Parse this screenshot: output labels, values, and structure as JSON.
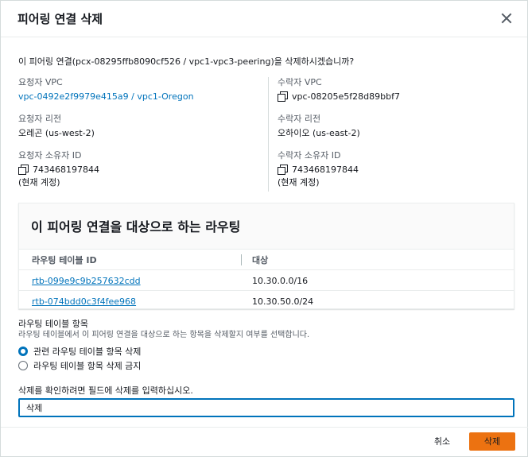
{
  "dialog": {
    "title": "피어링 연결 삭제",
    "question": "이 피어링 연결(pcx-08295ffb8090cf526 / vpc1-vpc3-peering)을 삭제하시겠습니까?"
  },
  "requester": {
    "vpc_label": "요청자 VPC",
    "vpc_value": "vpc-0492e2f9979e415a9 / vpc1-Oregon",
    "region_label": "요청자 리전",
    "region_value": "오레곤 (us-west-2)",
    "owner_label": "요청자 소유자 ID",
    "owner_value": "743468197844",
    "owner_note": "(현재 계정)"
  },
  "accepter": {
    "vpc_label": "수락자 VPC",
    "vpc_value": "vpc-08205e5f28d89bbf7",
    "region_label": "수락자 리전",
    "region_value": "오하이오 (us-east-2)",
    "owner_label": "수락자 소유자 ID",
    "owner_value": "743468197844",
    "owner_note": "(현재 계정)"
  },
  "routes": {
    "title": "이 피어링 연결을 대상으로 하는 라우팅",
    "columns": [
      "라우팅 테이블 ID",
      "대상"
    ],
    "rows": [
      [
        "rtb-099e9c9b257632cdd",
        "10.30.0.0/16"
      ],
      [
        "rtb-074bdd0c3f4fee968",
        "10.30.50.0/24"
      ]
    ]
  },
  "route_entries": {
    "title": "라우팅 테이블 항목",
    "description": "라우팅 테이블에서 이 피어링 연결을 대상으로 하는 항목을 삭제할지 여부를 선택합니다.",
    "options": [
      {
        "label": "관련 라우팅 테이블 항목 삭제",
        "checked": true
      },
      {
        "label": "라우팅 테이블 항목 삭제 금지",
        "checked": false
      }
    ]
  },
  "confirm": {
    "label": "삭제를 확인하려면 필드에 삭제를 입력하십시오.",
    "value": "삭제"
  },
  "footer": {
    "cancel_label": "취소",
    "delete_label": "삭제"
  },
  "colors": {
    "primary_button": "#ec7211",
    "link": "#0073bb"
  }
}
